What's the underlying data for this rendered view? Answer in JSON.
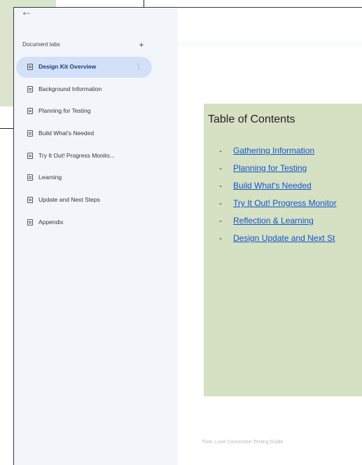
{
  "sidebar": {
    "back_icon": "arrow-back-icon",
    "header_title": "Document tabs",
    "add_tab_label": "+",
    "tabs": [
      {
        "label": "Design Kit Overview",
        "active": true
      },
      {
        "label": "Background Information"
      },
      {
        "label": "Planning for Testing"
      },
      {
        "label": "Build What's Needed"
      },
      {
        "label": "Try It Out! Progress Monito..."
      },
      {
        "label": "Learning"
      },
      {
        "label": "Update and Next Steps"
      },
      {
        "label": "Appendix"
      }
    ],
    "more_label": "⋮"
  },
  "document": {
    "toc": {
      "title": "Table of Contents",
      "items": [
        "Gathering Information",
        "Planning for Testing",
        "Build What's Needed",
        "Try It Out! Progress Monitor",
        "Reflection & Learning",
        "Design Update and Next St"
      ]
    },
    "footer": "Time, Love Connection Testing Guide"
  },
  "colors": {
    "sidebar_bg": "#f2f6fb",
    "active_tab": "#d3e1f8",
    "toc_bg": "#d6e1c4",
    "link": "#1155cc"
  }
}
